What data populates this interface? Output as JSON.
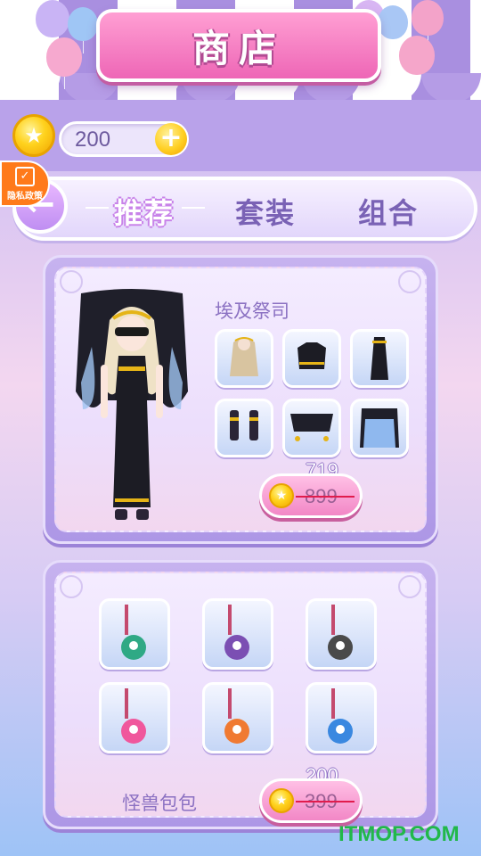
{
  "header": {
    "title": "商店"
  },
  "currency": {
    "amount": "200",
    "add_label": "+"
  },
  "privacy": {
    "label": "隐私政策"
  },
  "tabs": [
    {
      "label": "推荐",
      "active": true
    },
    {
      "label": "套装",
      "active": false
    },
    {
      "label": "组合",
      "active": false
    }
  ],
  "back_label": "←",
  "outfit_set": {
    "name": "埃及祭司",
    "items": [
      "hair-icon",
      "top-icon",
      "skirt-icon",
      "shoes-icon",
      "crown-icon",
      "veil-icon"
    ],
    "price_new": "719",
    "price_old": "899"
  },
  "bag_set": {
    "name": "怪兽包包",
    "items": [
      {
        "icon": "monster-bag-icon",
        "color": "#2fa985"
      },
      {
        "icon": "monster-bag-icon",
        "color": "#7b4fb3"
      },
      {
        "icon": "monster-bag-icon",
        "color": "#4a4a4a"
      },
      {
        "icon": "monster-bag-icon",
        "color": "#f0579c"
      },
      {
        "icon": "monster-bag-icon",
        "color": "#f07a32"
      },
      {
        "icon": "monster-bag-icon",
        "color": "#3a88e0"
      }
    ],
    "price_new": "200",
    "price_old": "399"
  },
  "watermark": "ITMOP.COM"
}
